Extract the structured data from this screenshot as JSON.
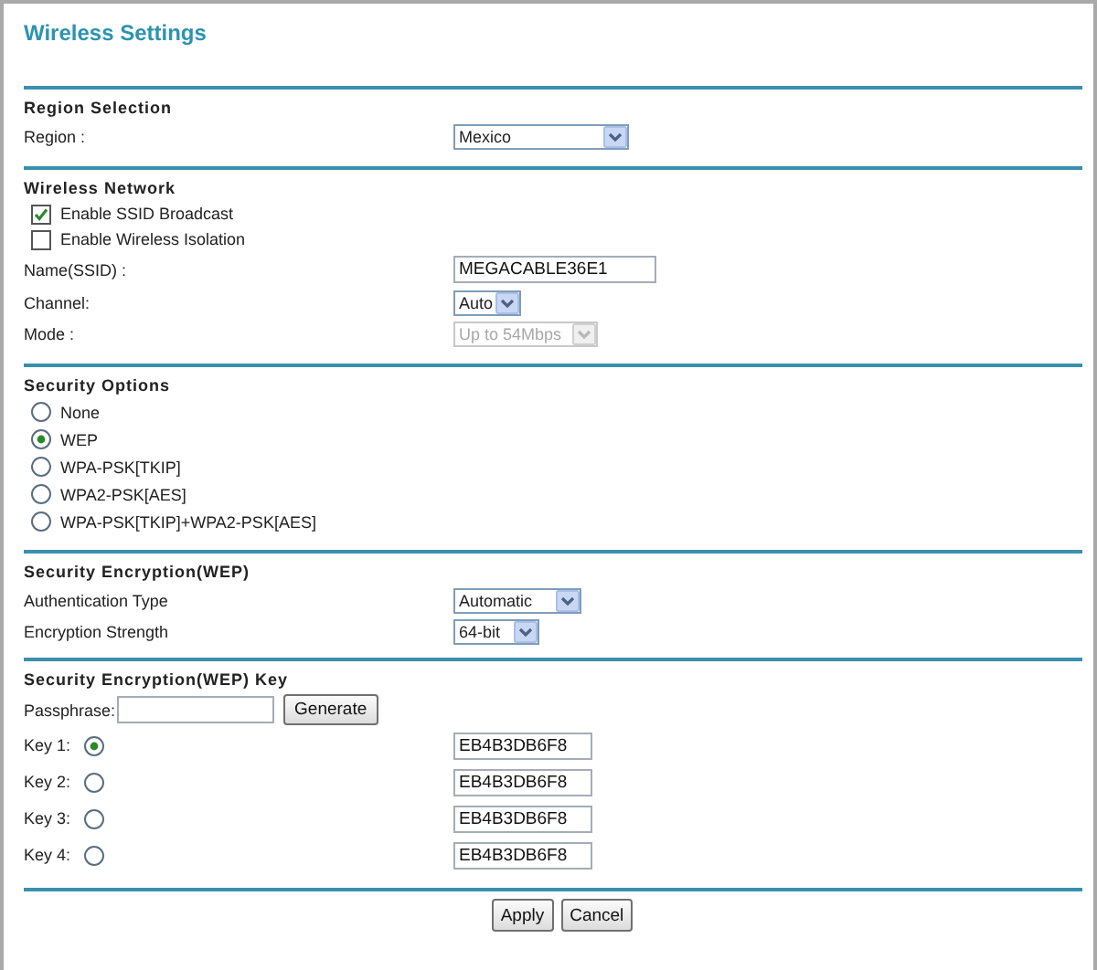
{
  "title": "Wireless Settings",
  "sections": [
    {
      "heading": "Region Selection",
      "rows": [
        {
          "kind": "select",
          "label": "Region :",
          "value": "Mexico",
          "disabled": false
        }
      ]
    },
    {
      "heading": "Wireless Network",
      "rows": [
        {
          "kind": "checkbox",
          "label": "Enable SSID Broadcast",
          "checked": true
        },
        {
          "kind": "checkbox",
          "label": "Enable Wireless Isolation",
          "checked": false
        },
        {
          "kind": "text",
          "label": "Name(SSID) :",
          "value": "MEGACABLE36E1"
        },
        {
          "kind": "select",
          "label": "Channel:",
          "value": "Auto",
          "disabled": false
        },
        {
          "kind": "select",
          "label": "Mode :",
          "value": "Up to 54Mbps",
          "disabled": true
        }
      ]
    },
    {
      "heading": "Security Options",
      "rows": [
        {
          "kind": "radio",
          "label": "None",
          "selected": false
        },
        {
          "kind": "radio",
          "label": "WEP",
          "selected": true
        },
        {
          "kind": "radio",
          "label": "WPA-PSK[TKIP]",
          "selected": false
        },
        {
          "kind": "radio",
          "label": "WPA2-PSK[AES]",
          "selected": false
        },
        {
          "kind": "radio",
          "label": "WPA-PSK[TKIP]+WPA2-PSK[AES]",
          "selected": false
        }
      ]
    },
    {
      "heading": "Security Encryption(WEP)",
      "rows": [
        {
          "kind": "select",
          "label": "Authentication Type",
          "value": "Automatic",
          "disabled": false
        },
        {
          "kind": "select",
          "label": "Encryption Strength",
          "value": "64-bit",
          "disabled": false
        }
      ]
    },
    {
      "heading": "Security Encryption(WEP) Key",
      "rows": [
        {
          "kind": "passphrase",
          "label": "Passphrase:",
          "button": "Generate"
        },
        {
          "kind": "key",
          "label": "Key 1:",
          "selected": true,
          "value": "EB4B3DB6F8"
        },
        {
          "kind": "key",
          "label": "Key 2:",
          "selected": false,
          "value": "EB4B3DB6F8"
        },
        {
          "kind": "key",
          "label": "Key 3:",
          "selected": false,
          "value": "EB4B3DB6F8"
        },
        {
          "kind": "key",
          "label": "Key 4:",
          "selected": false,
          "value": "EB4B3DB6F8"
        }
      ]
    }
  ],
  "buttons": [
    "Apply",
    "Cancel"
  ]
}
